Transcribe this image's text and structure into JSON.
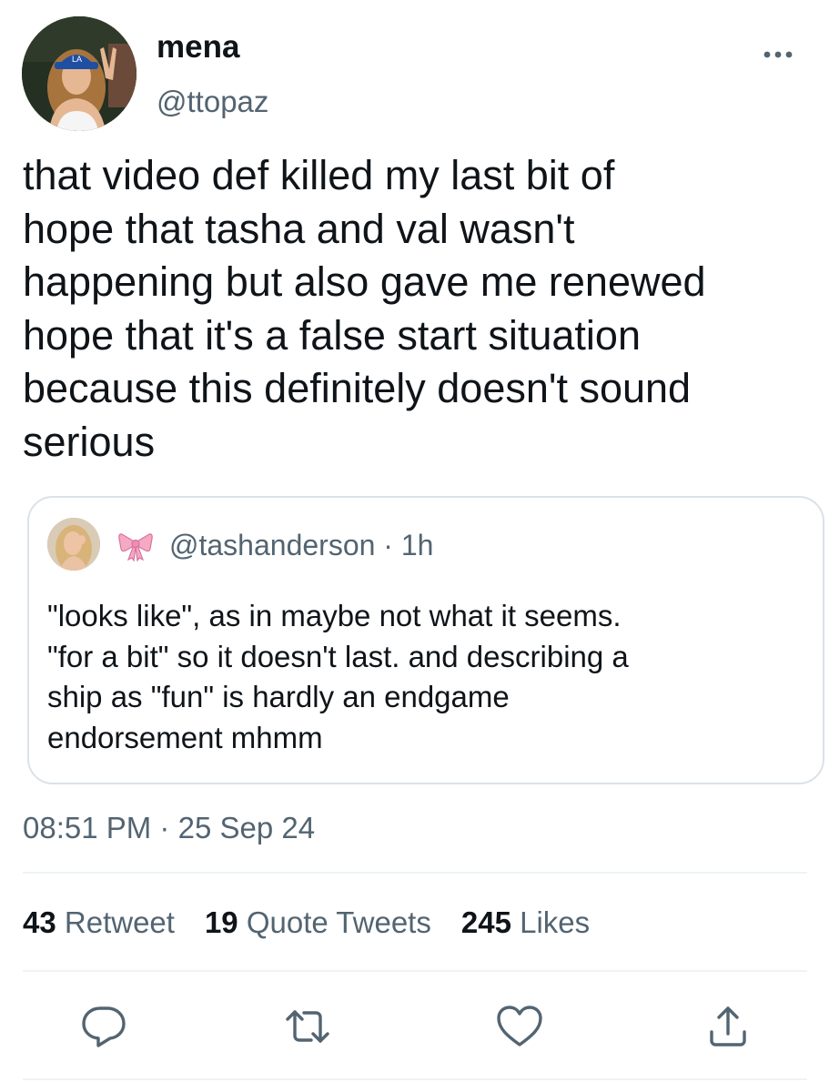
{
  "tweet": {
    "author": {
      "display_name": "mena",
      "handle": "@ttopaz",
      "avatar": "profile-photo"
    },
    "more_icon": "more-horizontal-icon",
    "text": "that video def killed my last bit of\nhope that tasha and val wasn't\nhappening but also gave me renewed\nhope that it's a false start situation\nbecause this definitely doesn't sound\nserious",
    "quoted": {
      "avatar": "profile-photo",
      "name_emoji": "ribbon-bow-icon",
      "handle": "@tashanderson",
      "separator": "·",
      "time": "1h",
      "text": "\"looks like\", as in maybe not what it seems.\n\"for a bit\" so it doesn't last. and describing a\nship as \"fun\" is hardly an endgame\nendorsement mhmm"
    },
    "timestamp": {
      "time": "08:51 PM",
      "separator": "·",
      "date": "25 Sep 24"
    },
    "stats": [
      {
        "count": "43",
        "label": "Retweet"
      },
      {
        "count": "19",
        "label": "Quote Tweets"
      },
      {
        "count": "245",
        "label": "Likes"
      }
    ],
    "actions": [
      "reply-icon",
      "retweet-icon",
      "like-heart-icon",
      "share-icon"
    ],
    "colors": {
      "text_primary": "#0f1419",
      "text_secondary": "#536471",
      "border": "#dbe2e7",
      "divider": "#eff3f4",
      "ribbon": "#f4a9c4"
    }
  }
}
